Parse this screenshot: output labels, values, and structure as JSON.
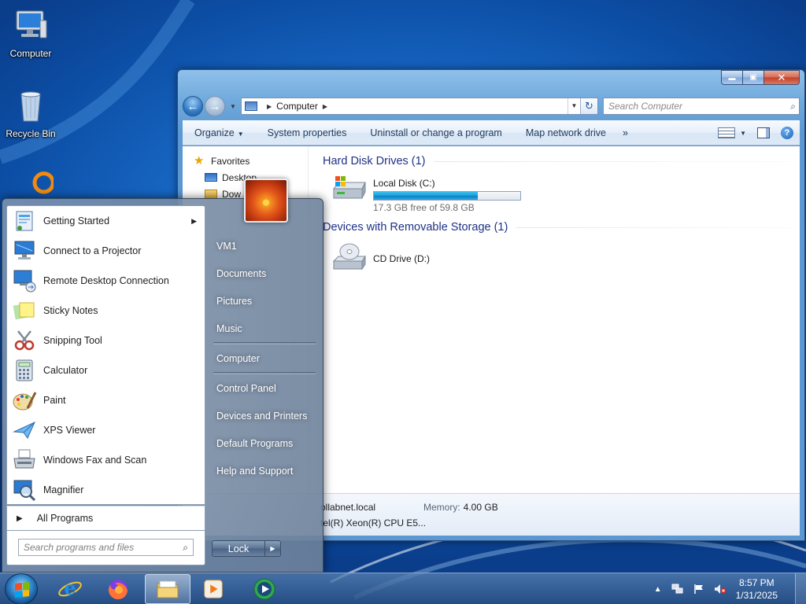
{
  "desktop": {
    "icons": [
      {
        "label": "Computer",
        "icon": "computer-icon"
      },
      {
        "label": "Recycle Bin",
        "icon": "recycle-bin-icon"
      }
    ]
  },
  "explorer": {
    "address_path": "Computer",
    "search_placeholder": "Search Computer",
    "caption": {
      "min": "▬",
      "max": "▣",
      "close": "✕"
    },
    "commands": {
      "organize": "Organize",
      "system_properties": "System properties",
      "uninstall": "Uninstall or change a program",
      "map_drive": "Map network drive",
      "more": "»"
    },
    "nav": {
      "favorites": "Favorites",
      "desktop": "Desktop",
      "downloads": "Dow"
    },
    "groups": {
      "hdd_header": "Hard Disk Drives (1)",
      "removable_header": "Devices with Removable Storage (1)"
    },
    "drives": {
      "c_name": "Local Disk (C:)",
      "c_free": "17.3 GB free of 59.8 GB",
      "c_used_fraction": 0.71,
      "d_name": "CD Drive (D:)"
    },
    "details": {
      "domain": "ollabnet.local",
      "processor": "tel(R) Xeon(R) CPU E5...",
      "memory_label": "Memory:",
      "memory_value": "4.00 GB"
    }
  },
  "start_menu": {
    "programs": [
      {
        "label": "Getting Started",
        "icon": "getting-started-icon",
        "submenu": true
      },
      {
        "label": "Connect to a Projector",
        "icon": "projector-icon"
      },
      {
        "label": "Remote Desktop Connection",
        "icon": "remote-desktop-icon"
      },
      {
        "label": "Sticky Notes",
        "icon": "sticky-notes-icon"
      },
      {
        "label": "Snipping Tool",
        "icon": "snipping-tool-icon"
      },
      {
        "label": "Calculator",
        "icon": "calculator-icon"
      },
      {
        "label": "Paint",
        "icon": "paint-icon"
      },
      {
        "label": "XPS Viewer",
        "icon": "xps-viewer-icon"
      },
      {
        "label": "Windows Fax and Scan",
        "icon": "fax-scan-icon"
      },
      {
        "label": "Magnifier",
        "icon": "magnifier-icon"
      }
    ],
    "all_programs": "All Programs",
    "search_placeholder": "Search programs and files",
    "right_items": {
      "user": "VM1",
      "documents": "Documents",
      "pictures": "Pictures",
      "music": "Music",
      "computer": "Computer",
      "control_panel": "Control Panel",
      "devices_printers": "Devices and Printers",
      "default_programs": "Default Programs",
      "help_support": "Help and Support"
    },
    "lock_label": "Lock"
  },
  "taskbar": {
    "pinned": [
      "internet-explorer-icon",
      "firefox-icon",
      "file-explorer-icon",
      "media-player-icon",
      "media-center-icon"
    ],
    "active": "file-explorer-icon",
    "clock_time": "8:57 PM",
    "clock_date": "1/31/2025"
  },
  "colors": {
    "desktop_blue": "#1766c2",
    "group_header": "#1e3287",
    "progress_fill": "#1e99d7"
  }
}
